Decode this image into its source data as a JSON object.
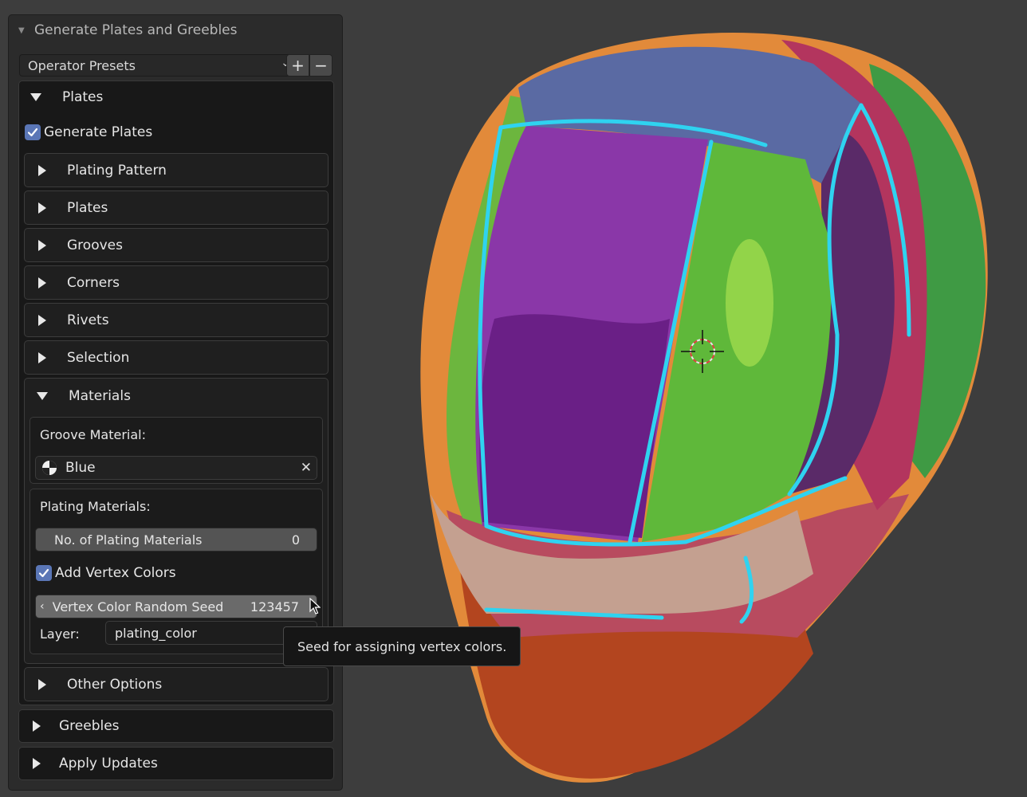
{
  "panel": {
    "title": "Generate Plates and Greebles",
    "presets_label": "Operator Presets",
    "add_preset_symbol": "+",
    "remove_preset_symbol": "−"
  },
  "plates_section": {
    "label": "Plates",
    "generate_plates_label": "Generate Plates",
    "generate_plates_checked": true,
    "subsections": [
      "Plating Pattern",
      "Plates",
      "Grooves",
      "Corners",
      "Rivets",
      "Selection"
    ],
    "materials_label": "Materials",
    "other_options_label": "Other Options"
  },
  "materials": {
    "groove_material_label": "Groove Material:",
    "groove_material_value": "Blue",
    "clear_symbol": "✕",
    "plating_materials_label": "Plating Materials:",
    "num_plating_label": "No. of Plating Materials",
    "num_plating_value": "0",
    "add_vertex_colors_label": "Add Vertex Colors",
    "add_vertex_colors_checked": true,
    "seed_label": "Vertex Color Random Seed",
    "seed_value": "123457",
    "layer_label": "Layer:",
    "layer_value": "plating_color"
  },
  "tooltip": {
    "text": "Seed for assigning vertex colors."
  },
  "greebles_label": "Greebles",
  "apply_updates_label": "Apply Updates",
  "colors": {
    "viewport_bg": "#3d3d3d",
    "checkbox_accent": "#5a76b6",
    "groove_cyan": "#2fd3f0",
    "outline_orange": "#f0a030"
  }
}
